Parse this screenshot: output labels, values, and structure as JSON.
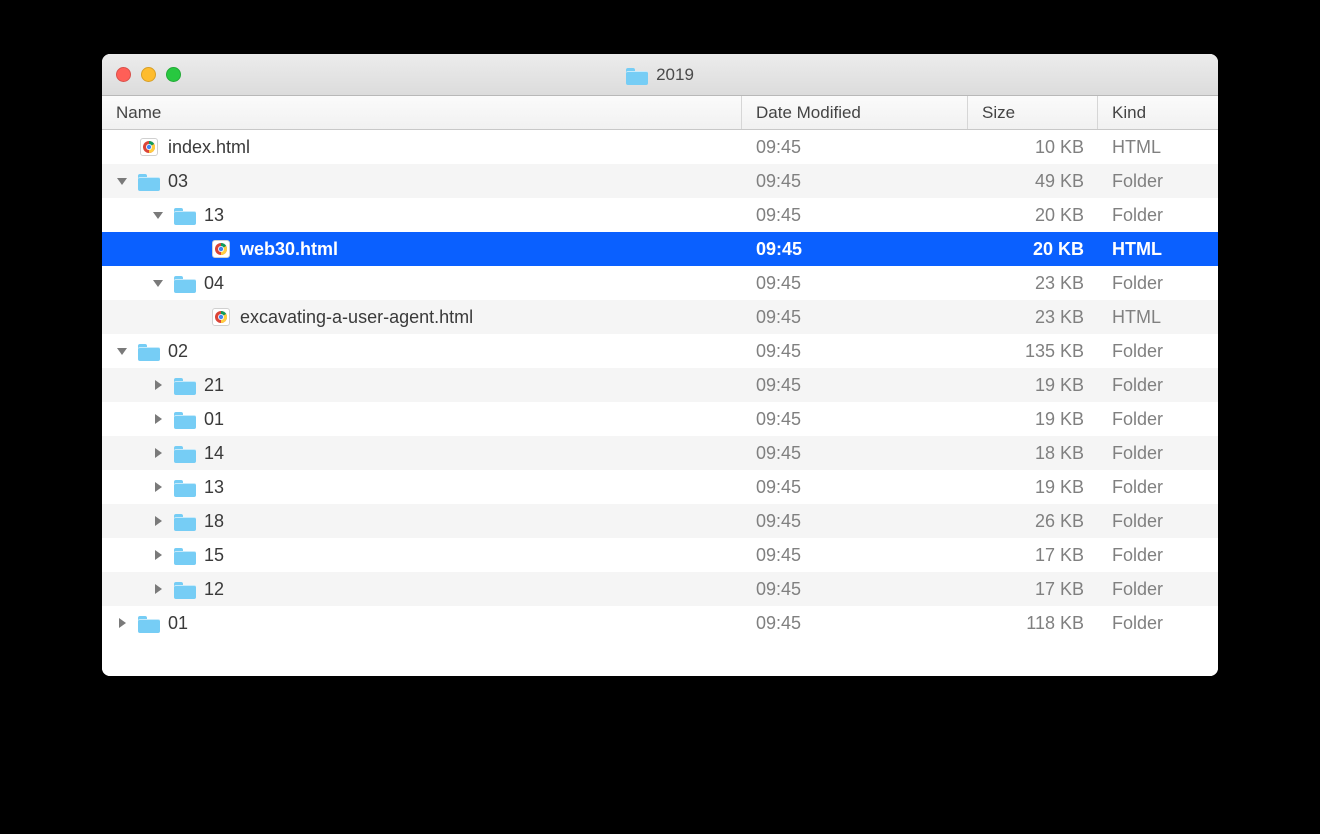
{
  "title": "2019",
  "columns": {
    "name": "Name",
    "date": "Date Modified",
    "size": "Size",
    "kind": "Kind"
  },
  "rows": [
    {
      "indent": 0,
      "arrow": "none",
      "icon": "html",
      "name": "index.html",
      "date": "09:45",
      "size": "10 KB",
      "kind": "HTML",
      "selected": false
    },
    {
      "indent": 0,
      "arrow": "down",
      "icon": "folder",
      "name": "03",
      "date": "09:45",
      "size": "49 KB",
      "kind": "Folder",
      "selected": false
    },
    {
      "indent": 1,
      "arrow": "down",
      "icon": "folder",
      "name": "13",
      "date": "09:45",
      "size": "20 KB",
      "kind": "Folder",
      "selected": false
    },
    {
      "indent": 2,
      "arrow": "none",
      "icon": "html",
      "name": "web30.html",
      "date": "09:45",
      "size": "20 KB",
      "kind": "HTML",
      "selected": true
    },
    {
      "indent": 1,
      "arrow": "down",
      "icon": "folder",
      "name": "04",
      "date": "09:45",
      "size": "23 KB",
      "kind": "Folder",
      "selected": false
    },
    {
      "indent": 2,
      "arrow": "none",
      "icon": "html",
      "name": "excavating-a-user-agent.html",
      "date": "09:45",
      "size": "23 KB",
      "kind": "HTML",
      "selected": false
    },
    {
      "indent": 0,
      "arrow": "down",
      "icon": "folder",
      "name": "02",
      "date": "09:45",
      "size": "135 KB",
      "kind": "Folder",
      "selected": false
    },
    {
      "indent": 1,
      "arrow": "right",
      "icon": "folder",
      "name": "21",
      "date": "09:45",
      "size": "19 KB",
      "kind": "Folder",
      "selected": false
    },
    {
      "indent": 1,
      "arrow": "right",
      "icon": "folder",
      "name": "01",
      "date": "09:45",
      "size": "19 KB",
      "kind": "Folder",
      "selected": false
    },
    {
      "indent": 1,
      "arrow": "right",
      "icon": "folder",
      "name": "14",
      "date": "09:45",
      "size": "18 KB",
      "kind": "Folder",
      "selected": false
    },
    {
      "indent": 1,
      "arrow": "right",
      "icon": "folder",
      "name": "13",
      "date": "09:45",
      "size": "19 KB",
      "kind": "Folder",
      "selected": false
    },
    {
      "indent": 1,
      "arrow": "right",
      "icon": "folder",
      "name": "18",
      "date": "09:45",
      "size": "26 KB",
      "kind": "Folder",
      "selected": false
    },
    {
      "indent": 1,
      "arrow": "right",
      "icon": "folder",
      "name": "15",
      "date": "09:45",
      "size": "17 KB",
      "kind": "Folder",
      "selected": false
    },
    {
      "indent": 1,
      "arrow": "right",
      "icon": "folder",
      "name": "12",
      "date": "09:45",
      "size": "17 KB",
      "kind": "Folder",
      "selected": false
    },
    {
      "indent": 0,
      "arrow": "right",
      "icon": "folder",
      "name": "01",
      "date": "09:45",
      "size": "118 KB",
      "kind": "Folder",
      "selected": false
    }
  ]
}
